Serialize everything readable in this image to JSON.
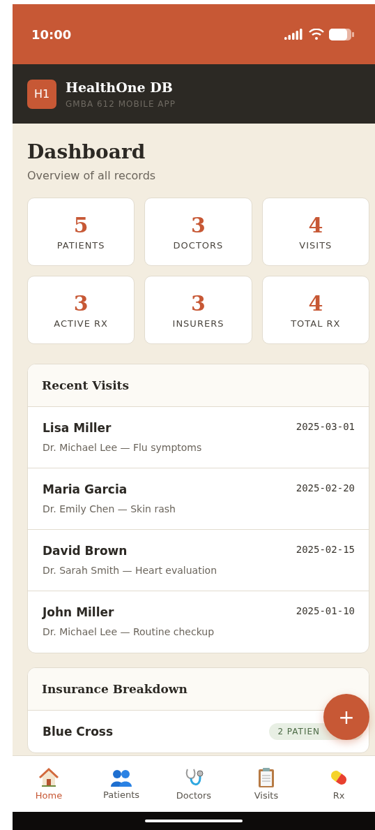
{
  "status_bar": {
    "time": "10:00"
  },
  "app_header": {
    "logo": "H1",
    "title": "HealthOne DB",
    "subtitle": "GMBA 612 MOBILE APP"
  },
  "page": {
    "title": "Dashboard",
    "subtitle": "Overview of all records"
  },
  "stats": [
    {
      "value": "5",
      "label": "PATIENTS"
    },
    {
      "value": "3",
      "label": "DOCTORS"
    },
    {
      "value": "4",
      "label": "VISITS"
    },
    {
      "value": "3",
      "label": "ACTIVE RX"
    },
    {
      "value": "3",
      "label": "INSURERS"
    },
    {
      "value": "4",
      "label": "TOTAL RX"
    }
  ],
  "recent_visits": {
    "title": "Recent Visits",
    "rows": [
      {
        "patient": "Lisa Miller",
        "detail": "Dr. Michael Lee — Flu symptoms",
        "date": "2025-03-01"
      },
      {
        "patient": "Maria Garcia",
        "detail": "Dr. Emily Chen — Skin rash",
        "date": "2025-02-20"
      },
      {
        "patient": "David Brown",
        "detail": "Dr. Sarah Smith — Heart evaluation",
        "date": "2025-02-15"
      },
      {
        "patient": "John Miller",
        "detail": "Dr. Michael Lee — Routine checkup",
        "date": "2025-01-10"
      }
    ]
  },
  "insurance_breakdown": {
    "title": "Insurance Breakdown",
    "rows": [
      {
        "name": "Blue Cross",
        "badge": "2 PATIEN"
      }
    ]
  },
  "fab": {
    "label": "+"
  },
  "bottom_nav": [
    {
      "kind": "home",
      "label": "Home",
      "selected": true
    },
    {
      "kind": "patients",
      "label": "Patients",
      "selected": false
    },
    {
      "kind": "doctors",
      "label": "Doctors",
      "selected": false
    },
    {
      "kind": "visits",
      "label": "Visits",
      "selected": false
    },
    {
      "kind": "rx",
      "label": "Rx",
      "selected": false
    }
  ]
}
